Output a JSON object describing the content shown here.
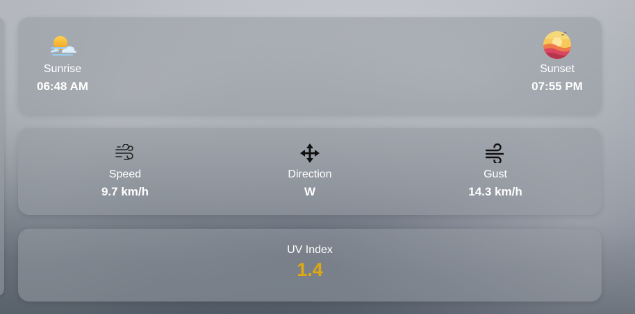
{
  "sun": {
    "sunrise": {
      "label": "Sunrise",
      "time": "06:48 AM",
      "icon": "sunrise-icon"
    },
    "sunset": {
      "label": "Sunset",
      "time": "07:55 PM",
      "icon": "sunset-icon"
    }
  },
  "wind": {
    "speed": {
      "label": "Speed",
      "value": "9.7 km/h",
      "icon": "wind-speed-icon"
    },
    "direction": {
      "label": "Direction",
      "value": "W",
      "icon": "direction-arrows-icon"
    },
    "gust": {
      "label": "Gust",
      "value": "14.3 km/h",
      "icon": "wind-gust-icon"
    }
  },
  "uv": {
    "label": "UV Index",
    "value": "1.4",
    "value_color": "#e0a910"
  }
}
